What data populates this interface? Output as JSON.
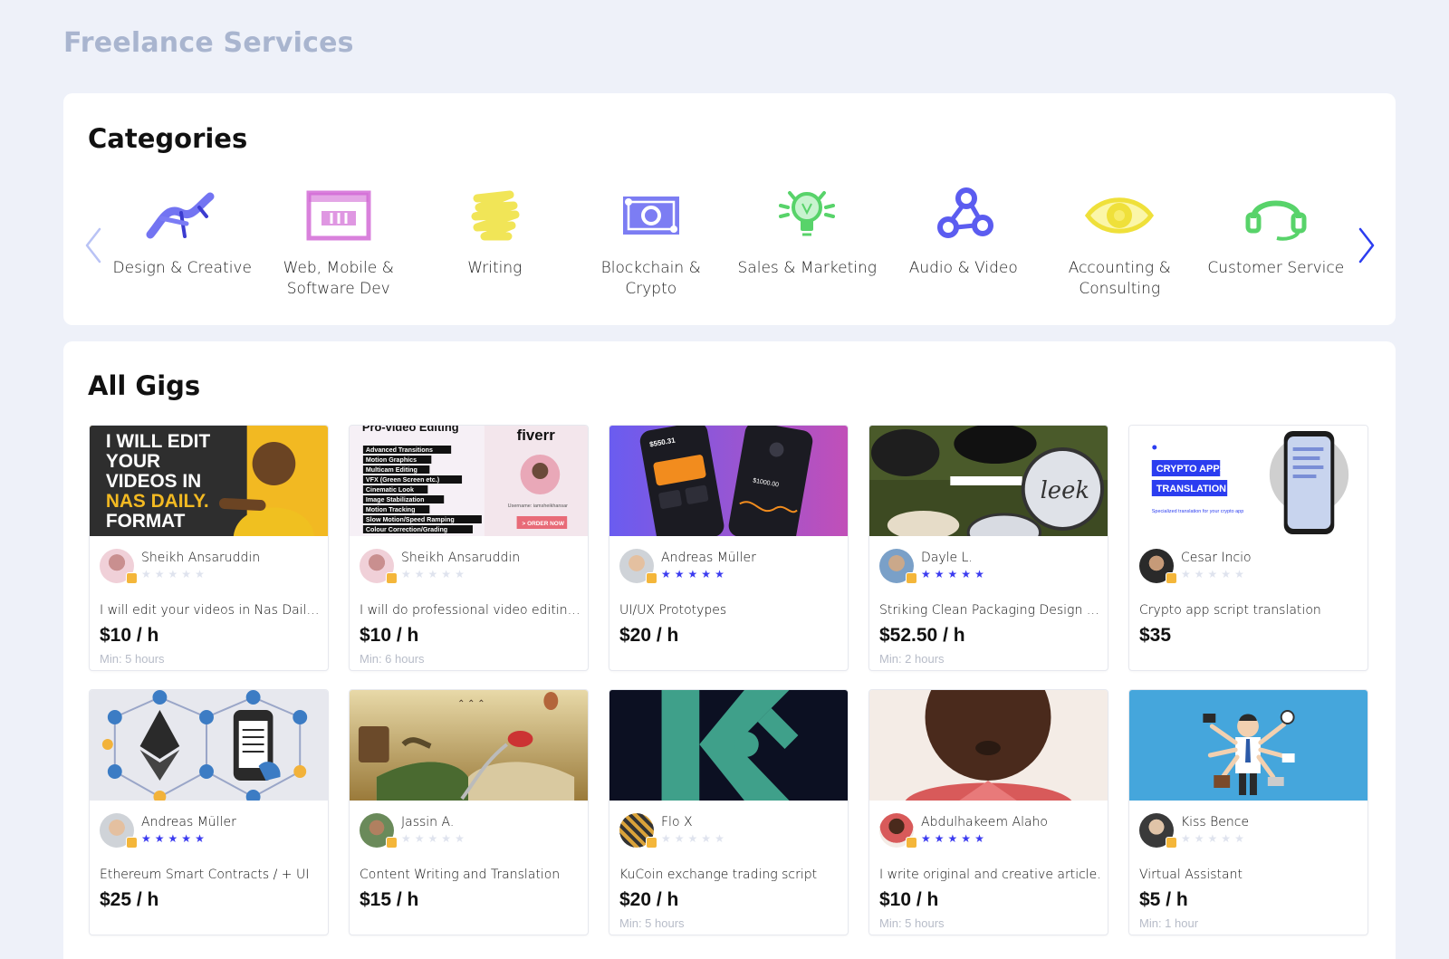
{
  "page": {
    "title": "Freelance Services"
  },
  "categories": {
    "title": "Categories",
    "items": [
      {
        "label": "Design & Creative",
        "icon": "design-pen-icon",
        "color": "#5b5cf0"
      },
      {
        "label": "Web, Mobile & Software Dev",
        "icon": "browser-window-icon",
        "color": "#d26bd6"
      },
      {
        "label": "Writing",
        "icon": "writing-scribble-icon",
        "color": "#f2e24a"
      },
      {
        "label": "Blockchain & Crypto",
        "icon": "banknote-icon",
        "color": "#5b5cf0"
      },
      {
        "label": "Sales & Marketing",
        "icon": "lightbulb-icon",
        "color": "#58d36a"
      },
      {
        "label": "Audio & Video",
        "icon": "nodes-icon",
        "color": "#5b5cf0"
      },
      {
        "label": "Accounting & Consulting",
        "icon": "eye-icon",
        "color": "#f2e24a"
      },
      {
        "label": "Customer Service",
        "icon": "headset-icon",
        "color": "#58d36a"
      }
    ]
  },
  "gigs": {
    "title": "All Gigs",
    "items": [
      {
        "seller": "Sheikh Ansaruddin",
        "rating": 0,
        "title": "I will edit your videos in Nas Daily format",
        "price": "$10 / h",
        "min": "Min: 5 hours",
        "thumb": "nas-daily-thumbnail",
        "thumb_text": [
          "I WILL EDIT",
          "YOUR",
          "VIDEOS IN",
          "NAS DAILY.",
          "FORMAT"
        ]
      },
      {
        "seller": "Sheikh Ansaruddin",
        "rating": 0,
        "title": "I will do professional video editing for you",
        "price": "$10 / h",
        "min": "Min: 6 hours",
        "thumb": "fiverr-video-editing-thumbnail",
        "thumb_text": [
          "Pro-video Editing",
          "fiverr",
          "Advanced Transitions",
          "Motion Graphics",
          "Multicam Editing",
          "VFX (Green Screen etc.)",
          "Cinematic Look",
          "Image Stabilization",
          "Motion Tracking",
          "Slow Motion/Speed Ramping",
          "Colour Correction/Grading",
          "Username: iamsheikhansar",
          "> ORDER NOW"
        ]
      },
      {
        "seller": "Andreas Müller",
        "rating": 5,
        "title": "UI/UX Prototypes",
        "price": "$20 / h",
        "min": "",
        "thumb": "phone-ui-thumbnail",
        "thumb_text": [
          "$550.31",
          "$1000.00"
        ]
      },
      {
        "seller": "Dayle L.",
        "rating": 5,
        "title": "Striking Clean Packaging Design For Your Products",
        "price": "$52.50 / h",
        "min": "Min: 2 hours",
        "thumb": "packaging-thumbnail",
        "thumb_text": [
          "leek"
        ]
      },
      {
        "seller": "Cesar Incio",
        "rating": 0,
        "title": "Crypto app script translation",
        "price": "$35",
        "min": "",
        "thumb": "crypto-translation-thumbnail",
        "thumb_text": [
          "CRYPTO APPS",
          "TRANSLATION",
          "Specialized translation for your crypto app"
        ]
      },
      {
        "seller": "Andreas Müller",
        "rating": 5,
        "title": "Ethereum Smart Contracts / + UI",
        "price": "$25 / h",
        "min": "",
        "thumb": "ethereum-thumbnail",
        "thumb_text": []
      },
      {
        "seller": "Jassin A.",
        "rating": 0,
        "title": "Content Writing and Translation",
        "price": "$15 / h",
        "min": "",
        "thumb": "book-landscape-thumbnail",
        "thumb_text": []
      },
      {
        "seller": "Flo X",
        "rating": 0,
        "title": "KuCoin exchange trading script",
        "price": "$20 / h",
        "min": "Min: 5 hours",
        "thumb": "kucoin-logo-thumbnail",
        "thumb_text": []
      },
      {
        "seller": "Abdulhakeem Alaho",
        "rating": 5,
        "title": "I write original and creative article.",
        "price": "$10 / h",
        "min": "Min: 5 hours",
        "thumb": "portrait-thumbnail",
        "thumb_text": []
      },
      {
        "seller": "Kiss Bence",
        "rating": 0,
        "title": "Virtual Assistant",
        "price": "$5 / h",
        "min": "Min: 1 hour",
        "thumb": "virtual-assistant-thumbnail",
        "thumb_text": []
      }
    ]
  },
  "colors": {
    "accent": "#3b3bf0",
    "background": "#eef1f9",
    "muted": "#b7bcc8"
  }
}
